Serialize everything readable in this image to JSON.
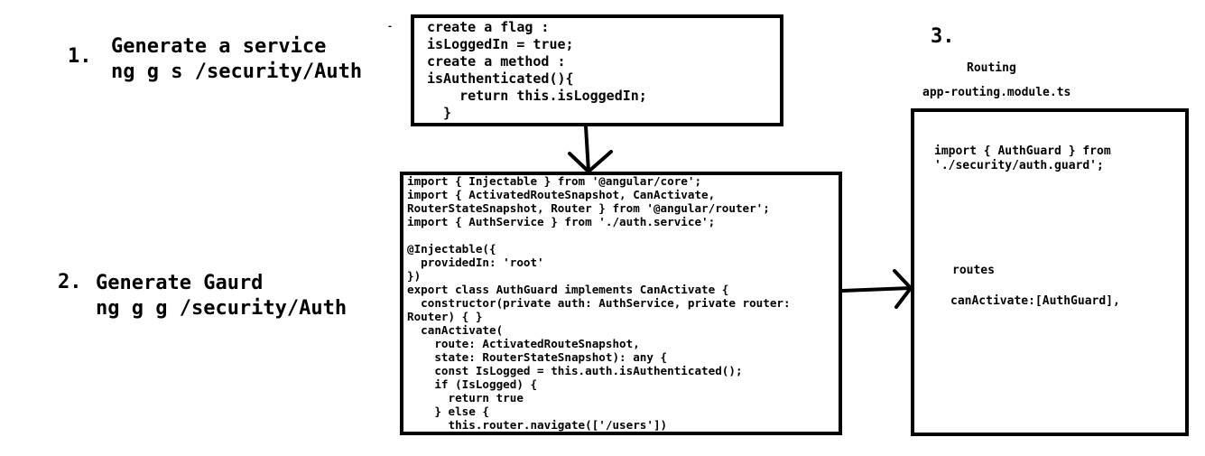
{
  "step1": {
    "number": "1.",
    "title": "Generate a service",
    "command": "ng g s /security/Auth"
  },
  "step2": {
    "number": "2.",
    "title": "Generate Gaurd",
    "command": "ng g g /security/Auth"
  },
  "step3": {
    "number": "3.",
    "title": "Routing",
    "file": "app-routing.module.ts"
  },
  "flag_box": {
    "lines": [
      "create a flag :",
      "isLoggedIn = true;",
      "create a method :",
      "isAuthenticated(){",
      "    return this.isLoggedIn;",
      "  }"
    ]
  },
  "guard_box": {
    "lines": [
      "import { Injectable } from '@angular/core';",
      "import { ActivatedRouteSnapshot, CanActivate,",
      "RouterStateSnapshot, Router } from '@angular/router';",
      "import { AuthService } from './auth.service';",
      "",
      "@Injectable({",
      "  providedIn: 'root'",
      "})",
      "export class AuthGuard implements CanActivate {",
      "  constructor(private auth: AuthService, private router:",
      "Router) { }",
      "  canActivate(",
      "    route: ActivatedRouteSnapshot,",
      "    state: RouterStateSnapshot): any {",
      "    const IsLogged = this.auth.isAuthenticated();",
      "    if (IsLogged) {",
      "      return true",
      "    } else {",
      "      this.router.navigate(['/users'])",
      "    }"
    ]
  },
  "routing_box": {
    "import_line1": "import { AuthGuard } from",
    "import_line2": "'./security/auth.guard';",
    "routes_label": "routes",
    "can_activate": "canActivate:[AuthGuard],"
  },
  "stray_mark": "-"
}
